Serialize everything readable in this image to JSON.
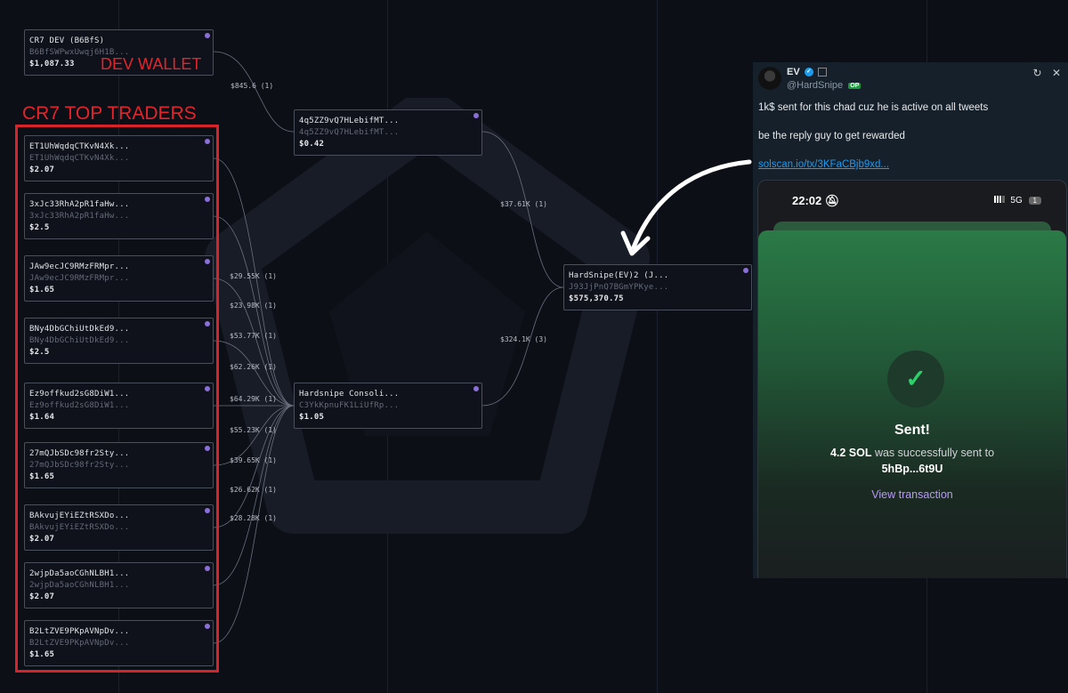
{
  "annotations": {
    "dev_wallet": "DEV WALLET",
    "top_traders": "CR7 TOP TRADERS"
  },
  "nodes": {
    "dev": {
      "name": "CR7 DEV (B6BfS)",
      "address": "B6BfSWPwxUwqj6H1B...",
      "balance": "$1,087.33"
    },
    "intermediate": {
      "name": "4q5ZZ9vQ7HLebifMT...",
      "address": "4q5ZZ9vQ7HLebifMT...",
      "balance": "$0.42"
    },
    "consolidator": {
      "name": "Hardsnipe Consoli...",
      "address": "C3YkKpnuFK1LiUfRp...",
      "balance": "$1.05"
    },
    "final": {
      "name": "HardSnipe(EV)2 (J...",
      "address": "J93JjPnQ7BGmYPKye...",
      "balance": "$575,370.75"
    },
    "traders": [
      {
        "name": "ET1UhWqdqCTKvN4Xk...",
        "address": "ET1UhWqdqCTKvN4Xk...",
        "balance": "$2.07"
      },
      {
        "name": "3xJc33RhA2pR1faHw...",
        "address": "3xJc33RhA2pR1faHw...",
        "balance": "$2.5"
      },
      {
        "name": "JAw9ecJC9RMzFRMpr...",
        "address": "JAw9ecJC9RMzFRMpr...",
        "balance": "$1.65"
      },
      {
        "name": "BNy4DbGChiUtDkEd9...",
        "address": "BNy4DbGChiUtDkEd9...",
        "balance": "$2.5"
      },
      {
        "name": "Ez9offkud2sG8DiW1...",
        "address": "Ez9offkud2sG8DiW1...",
        "balance": "$1.64"
      },
      {
        "name": "27mQJbSDc98fr2Sty...",
        "address": "27mQJbSDc98fr2Sty...",
        "balance": "$1.65"
      },
      {
        "name": "BAkvujEYiEZtRSXDo...",
        "address": "BAkvujEYiEZtRSXDo...",
        "balance": "$2.07"
      },
      {
        "name": "2wjpDa5aoCGhNLBH1...",
        "address": "2wjpDa5aoCGhNLBH1...",
        "balance": "$2.07"
      },
      {
        "name": "B2LtZVE9PKpAVNpDv...",
        "address": "B2LtZVE9PKpAVNpDv...",
        "balance": "$1.65"
      }
    ]
  },
  "edges": {
    "dev_to_intermediate": "$845.6 (1)",
    "intermediate_to_final": "$37.61K (1)",
    "consolidator_to_final": "$324.1K (3)",
    "traders_to_consolidator": [
      "$29.55K (1)",
      "$23.98K (1)",
      "$53.77K (1)",
      "$62.26K (1)",
      "$64.29K (1)",
      "$55.23K (1)",
      "$39.65K (1)",
      "$26.62K (1)",
      "$28.28K (1)"
    ]
  },
  "tweet": {
    "author": "EV",
    "handle": "@HardSnipe",
    "op_badge": "OP",
    "line1": "1k$ sent for this chad cuz he is active on all tweets",
    "line2": "be the reply guy to get rewarded",
    "link": "solscan.io/tx/3KFaCBjb9xd...",
    "phone": {
      "time": "22:02",
      "network": "5G",
      "battery": "1",
      "title": "Sent!",
      "amount": "4.2 SOL",
      "message": " was successfully sent to",
      "recipient": "5hBp...6t9U",
      "action": "View transaction"
    }
  },
  "colors": {
    "background": "#0c0f16",
    "annotation": "#e3242b",
    "node_dot": "#8b6fd8",
    "tweet_background": "#15202b",
    "link": "#1d9bf0",
    "success": "#2fcf6b"
  }
}
